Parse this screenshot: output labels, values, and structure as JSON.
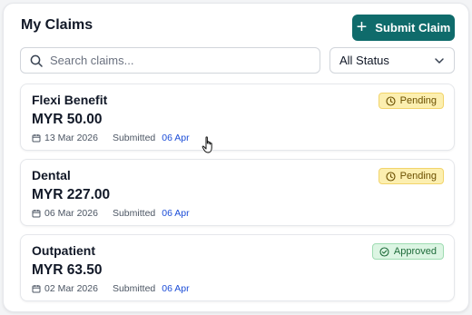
{
  "header": {
    "title": "My Claims",
    "submit_label": "Submit Claim"
  },
  "search": {
    "placeholder": "Search claims...",
    "value": ""
  },
  "filter": {
    "selected": "All Status"
  },
  "claims": [
    {
      "name": "Flexi Benefit",
      "amount": "MYR 50.00",
      "date": "13 Mar 2026",
      "submitted_label": "Submitted",
      "submitted_date": "06 Apr",
      "status": "Pending"
    },
    {
      "name": "Dental",
      "amount": "MYR 227.00",
      "date": "06 Mar 2026",
      "submitted_label": "Submitted",
      "submitted_date": "06 Apr",
      "status": "Pending"
    },
    {
      "name": "Outpatient",
      "amount": "MYR 63.50",
      "date": "02 Mar 2026",
      "submitted_label": "Submitted",
      "submitted_date": "06 Apr",
      "status": "Approved"
    }
  ],
  "colors": {
    "brand": "#0f6b6b",
    "pending_bg": "#fcefb0",
    "approved_bg": "#dcf5e3",
    "link": "#1d4ed8"
  }
}
